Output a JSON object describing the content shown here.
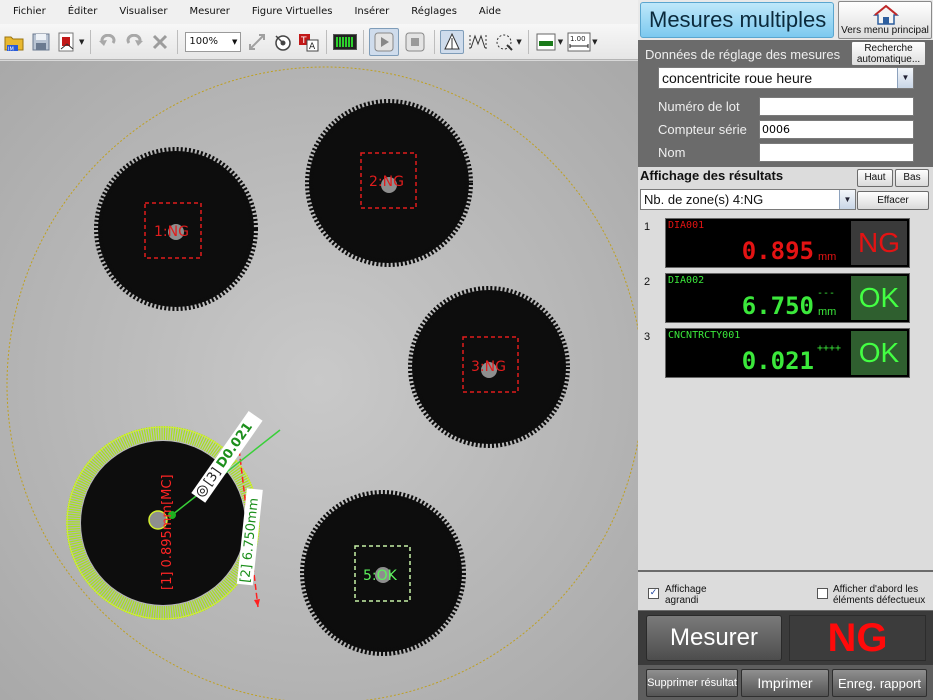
{
  "menu": [
    "Fichier",
    "Éditer",
    "Visualiser",
    "Mesurer",
    "Figure Virtuelles",
    "Insérer",
    "Réglages",
    "Aide"
  ],
  "toolbar": {
    "zoom": "100%",
    "scale_value": "1.00"
  },
  "image": {
    "zones": [
      {
        "label": "1:NG",
        "status": "NG"
      },
      {
        "label": "2:NG",
        "status": "NG"
      },
      {
        "label": "3:NG",
        "status": "NG"
      },
      {
        "label": "5:OK",
        "status": "OK"
      }
    ],
    "overlays": {
      "dia1": "[1] 0.895mm[MC]",
      "dia2": "[2] 6.750mm",
      "conc_tag": "[3]",
      "conc_value": "D0.021"
    }
  },
  "panel": {
    "title": "Mesures multiples",
    "main_menu_button": "Vers menu principal",
    "settings_label": "Données de réglage des mesures",
    "search_button": "Recherche automatique...",
    "setting_name": "concentricite roue heure",
    "fields": [
      {
        "label": "Numéro de lot",
        "value": ""
      },
      {
        "label": "Compteur série",
        "value": "0006"
      },
      {
        "label": "Nom",
        "value": ""
      }
    ],
    "results_title": "Affichage des résultats",
    "btn_up": "Haut",
    "btn_down": "Bas",
    "btn_clear": "Effacer",
    "zone_filter": "Nb. de zone(s) 4:NG",
    "results": [
      {
        "num": "1",
        "name": "DIA001",
        "value": "0.895",
        "unit": "mm",
        "extra": "",
        "judge": "NG",
        "color": "#e31313"
      },
      {
        "num": "2",
        "name": "DIA002",
        "value": "6.750",
        "unit": "mm",
        "extra": "---",
        "judge": "OK",
        "color": "#3be83b"
      },
      {
        "num": "3",
        "name": "CNCNTRCTY001",
        "value": "0.021",
        "unit": "",
        "extra": "++++",
        "judge": "OK",
        "color": "#3be83b"
      }
    ],
    "option_enlarged": "Affichage agrandi",
    "option_defective_first": "Afficher d'abord les éléments défectueux",
    "measure_button": "Mesurer",
    "global_judgement": "NG",
    "delete_result": "Supprimer résultat",
    "print": "Imprimer",
    "save_report": "Enreg. rapport"
  }
}
